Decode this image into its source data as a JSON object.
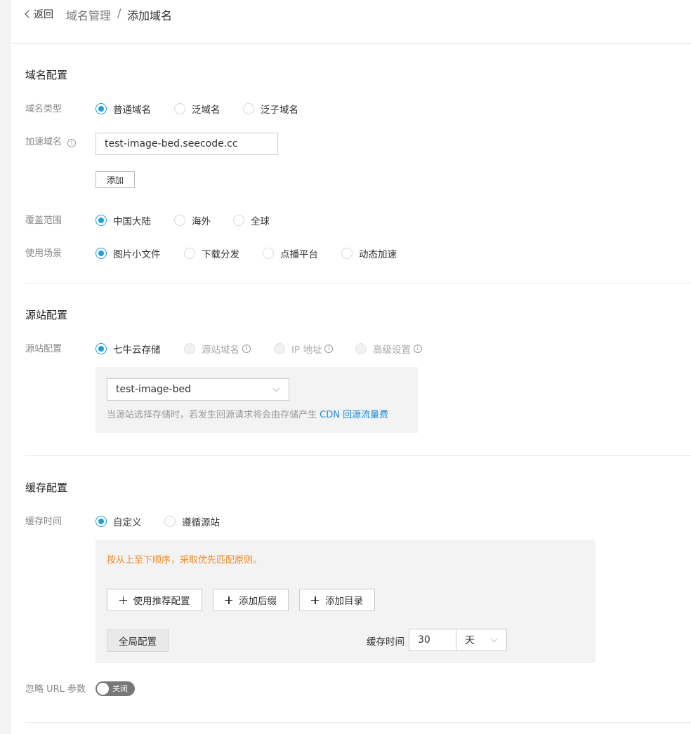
{
  "header": {
    "back_label": "返回",
    "breadcrumb_parent": "域名管理",
    "breadcrumb_sep": "/",
    "breadcrumb_current": "添加域名"
  },
  "domain_config": {
    "title": "域名配置",
    "domain_type": {
      "label": "域名类型",
      "options": [
        "普通域名",
        "泛域名",
        "泛子域名"
      ],
      "selected": "普通域名"
    },
    "accel_domain": {
      "label": "加速域名",
      "value": "test-image-bed.seecode.cc",
      "add_button": "添加"
    },
    "coverage": {
      "label": "覆盖范围",
      "options": [
        "中国大陆",
        "海外",
        "全球"
      ],
      "selected": "中国大陆"
    },
    "scenario": {
      "label": "使用场景",
      "options": [
        "图片小文件",
        "下载分发",
        "点播平台",
        "动态加速"
      ],
      "selected": "图片小文件"
    }
  },
  "origin_config": {
    "title": "源站配置",
    "origin": {
      "label": "源站配置",
      "options": [
        "七牛云存储",
        "源站域名",
        "IP 地址",
        "高级设置"
      ],
      "selected": "七牛云存储",
      "disabled": [
        "源站域名",
        "IP 地址",
        "高级设置"
      ]
    },
    "bucket_select": "test-image-bed",
    "hint_prefix": "当源站选择存储时，若发生回源请求将会由存储产生 ",
    "hint_link": "CDN 回源流量费"
  },
  "cache_config": {
    "title": "缓存配置",
    "cache_time": {
      "label": "缓存时间",
      "options": [
        "自定义",
        "遵循源站"
      ],
      "selected": "自定义"
    },
    "warning": "按从上至下顺序，采取优先匹配原则。",
    "buttons": {
      "recommend": "使用推荐配置",
      "add_suffix": "添加后缀",
      "add_dir": "添加目录"
    },
    "global_config": "全局配置",
    "cache_time_label": "缓存时间",
    "cache_time_value": "30",
    "cache_time_unit": "天",
    "ignore_url_params": {
      "label": "忽略 URL 参数",
      "toggle_label": "关闭",
      "on": false
    }
  },
  "colors": {
    "accent": "#1ea0d9",
    "link": "#1e8ad6",
    "warning": "#f08c28"
  }
}
